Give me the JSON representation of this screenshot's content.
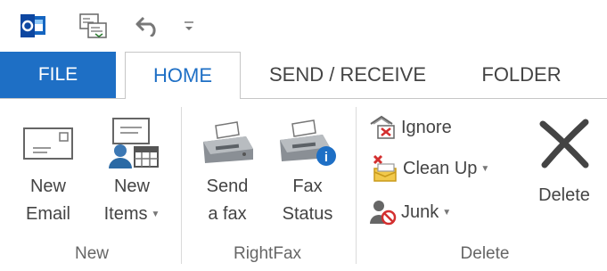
{
  "qat": {
    "app_icon": "outlook-icon",
    "items": [
      "send-receive-all-icon",
      "undo-icon",
      "customize-qat-icon"
    ]
  },
  "tabs": [
    {
      "name": "tab-file",
      "label": "FILE"
    },
    {
      "name": "tab-home",
      "label": "HOME"
    },
    {
      "name": "tab-send-receive",
      "label": "SEND / RECEIVE"
    },
    {
      "name": "tab-folder",
      "label": "FOLDER"
    }
  ],
  "groups": {
    "new": {
      "label": "New",
      "new_email": {
        "line1": "New",
        "line2": "Email",
        "icon": "envelope-icon"
      },
      "new_items": {
        "line1": "New",
        "line2": "Items",
        "icon": "new-items-icon"
      }
    },
    "rightfax": {
      "label": "RightFax",
      "send_fax": {
        "line1": "Send",
        "line2": "a fax",
        "icon": "fax-machine-icon"
      },
      "fax_status": {
        "line1": "Fax",
        "line2": "Status",
        "icon": "fax-status-icon"
      }
    },
    "delete": {
      "label": "Delete",
      "ignore": {
        "label": "Ignore",
        "icon": "ignore-icon"
      },
      "clean_up": {
        "label": "Clean Up",
        "icon": "clean-up-icon"
      },
      "junk": {
        "label": "Junk",
        "icon": "junk-icon"
      },
      "delete": {
        "label": "Delete",
        "icon": "delete-x-icon"
      }
    }
  },
  "colors": {
    "accent": "#1e6fc5",
    "border": "#c6c6c6",
    "text": "#444444"
  }
}
